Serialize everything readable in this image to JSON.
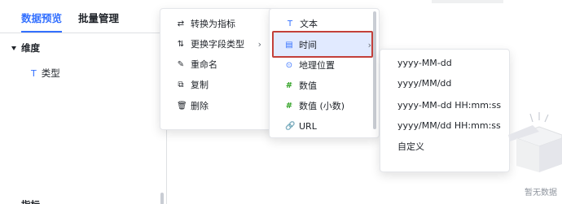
{
  "tabs": [
    {
      "label": "数据预览"
    },
    {
      "label": "批量管理"
    }
  ],
  "left_panel": {
    "section_title": "维度",
    "field": {
      "icon": "text-type-icon",
      "glyph": "T",
      "label": "类型"
    },
    "bottom_label_partial": "指标"
  },
  "context_menu": [
    {
      "icon": "swap-icon",
      "glyph": "⇄",
      "label": "转换为指标"
    },
    {
      "icon": "change-type-icon",
      "glyph": "⇅",
      "label": "更换字段类型",
      "has_submenu": true
    },
    {
      "icon": "rename-icon",
      "glyph": "✎",
      "label": "重命名"
    },
    {
      "icon": "copy-icon",
      "glyph": "⧉",
      "label": "复制"
    },
    {
      "icon": "delete-icon",
      "glyph": "🗑",
      "label": "删除"
    }
  ],
  "type_submenu": [
    {
      "icon": "text-type-icon",
      "glyph": "T",
      "label": "文本"
    },
    {
      "icon": "calendar-icon",
      "glyph": "▤",
      "label": "时间",
      "selected": true,
      "has_submenu": true
    },
    {
      "icon": "location-icon",
      "glyph": "⊙",
      "label": "地理位置"
    },
    {
      "icon": "number-icon",
      "glyph": "#",
      "label": "数值"
    },
    {
      "icon": "number-decimal-icon",
      "glyph": "#",
      "label": "数值 (小数)"
    },
    {
      "icon": "link-icon",
      "glyph": "🔗",
      "label": "URL"
    }
  ],
  "time_format_submenu": [
    {
      "label": "yyyy-MM-dd"
    },
    {
      "label": "yyyy/MM/dd"
    },
    {
      "label": "yyyy-MM-dd HH:mm:ss"
    },
    {
      "label": "yyyy/MM/dd HH:mm:ss"
    },
    {
      "label": "自定义"
    }
  ],
  "empty_state": {
    "text": "暂无数据"
  },
  "colors": {
    "accent": "#3370ff",
    "highlight_border": "#c3403a",
    "selected_bg": "#e1eaff",
    "number_icon": "#2ea121"
  }
}
